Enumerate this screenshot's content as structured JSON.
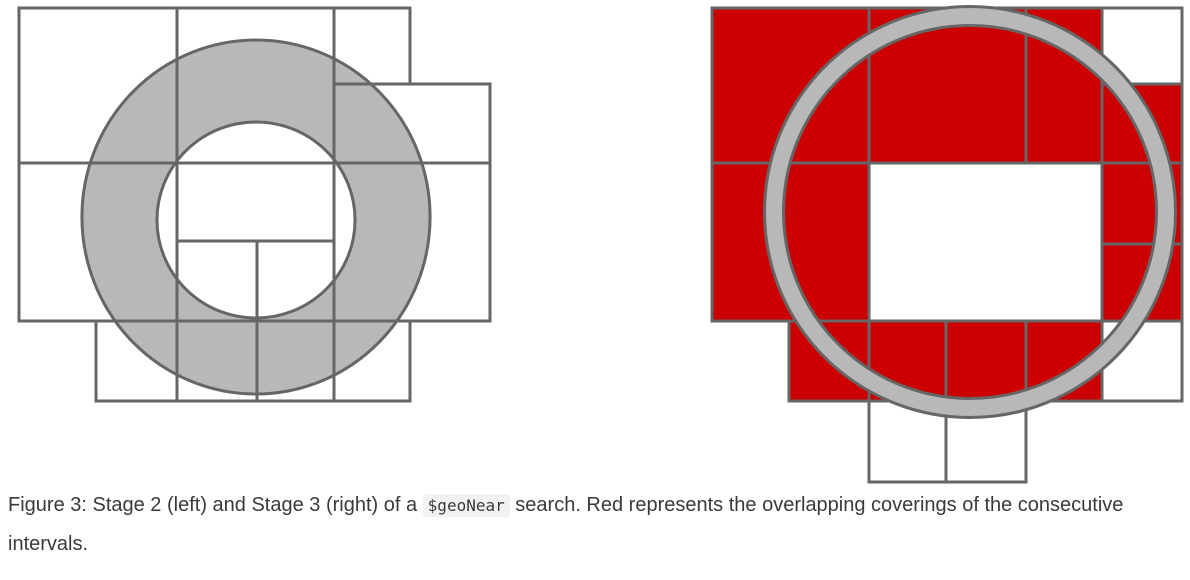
{
  "colors": {
    "grid": "#666666",
    "ring": "#b8b8b8",
    "covered": "#cc0000",
    "background": "#ffffff",
    "text": "#3a3a3a",
    "code_bg": "#f2f2f2"
  },
  "caption": {
    "before": "Figure 3: Stage 2 (left) and Stage 3 (right) of a ",
    "code": "$geoNear",
    "after": " search. Red represents the overlapping coverings of the consecutive intervals."
  }
}
